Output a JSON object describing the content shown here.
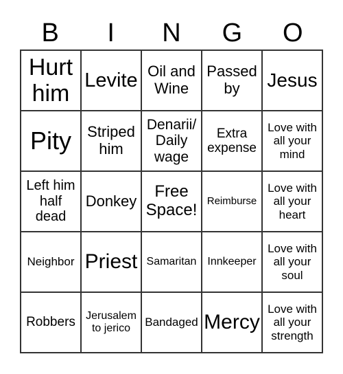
{
  "header": [
    "B",
    "I",
    "N",
    "G",
    "O"
  ],
  "cells": [
    "Hurt\nhim",
    "Levite",
    "Oil and\nWine",
    "Passed\nby",
    "Jesus",
    "Pity",
    "Striped\nhim",
    "Denarii/\nDaily\nwage",
    "Extra\nexpense",
    "Love with\nall your\nmind",
    "Left him\nhalf\ndead",
    "Donkey",
    "Free\nSpace!",
    "Reimburse",
    "Love with\nall your\nheart",
    "Neighbor",
    "Priest",
    "Samaritan",
    "Innkeeper",
    "Love with\nall your\nsoul",
    "Robbers",
    "Jerusalem\nto jerico",
    "Bandaged",
    "Mercy",
    "Love with\nall your\nstrength"
  ]
}
